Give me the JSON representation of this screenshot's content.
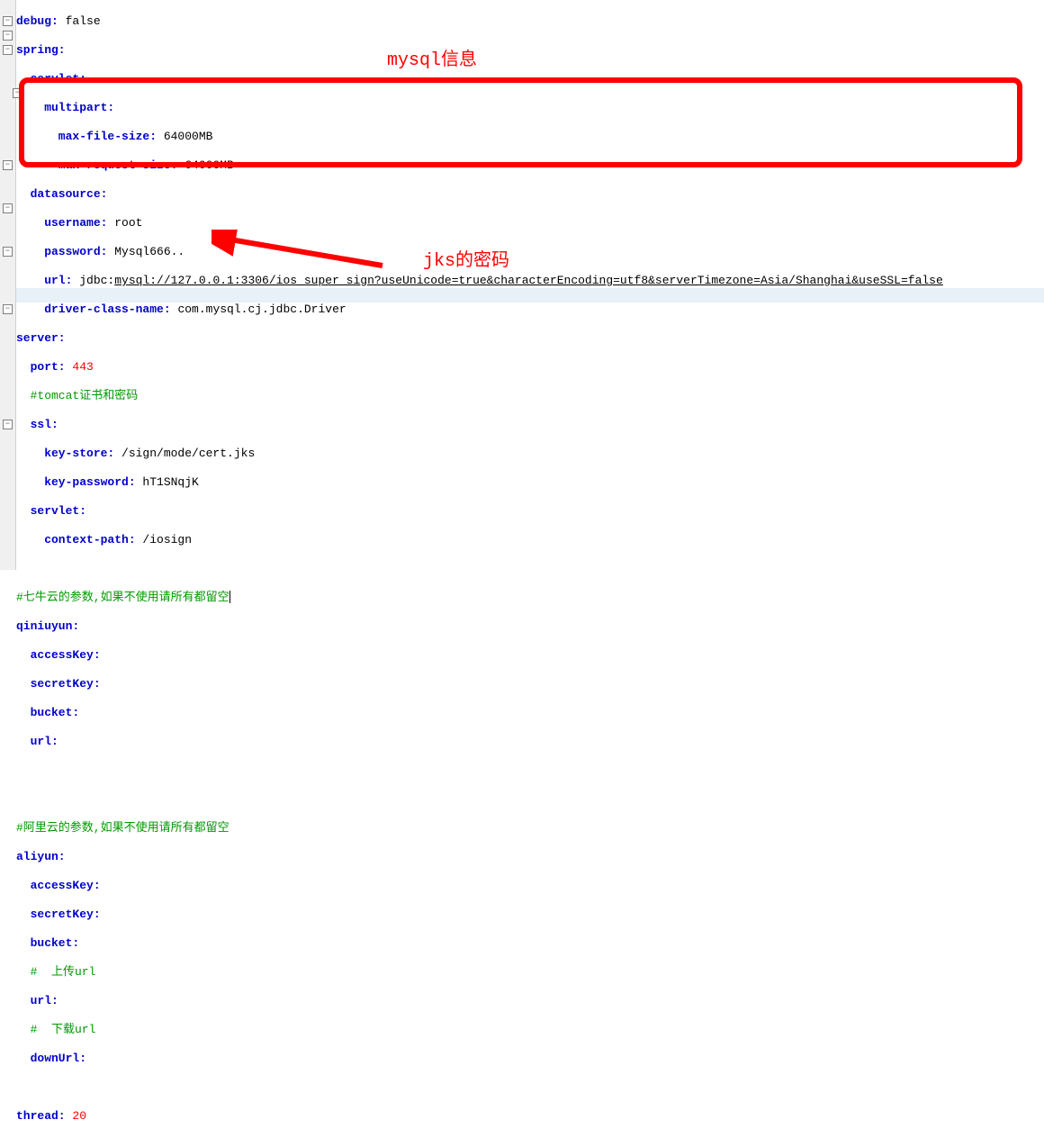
{
  "lines": {
    "l1_k": "debug:",
    "l1_v": " false",
    "l2_k": "spring:",
    "l3_k": "  servlet:",
    "l4_k": "    multipart:",
    "l5_k": "      max-file-size:",
    "l5_v": " 64000MB",
    "l6_k": "      max-request-size:",
    "l6_v": " 64000MB",
    "l7_k": "  datasource:",
    "l8_k": "    username:",
    "l8_v": " root",
    "l9_k": "    password:",
    "l9_v": " Mysql666..",
    "l10_k": "    url:",
    "l10_v1": " jdbc:",
    "l10_v2": "mysql://127.0.0.1:3306/ios_super_sign?useUnicode=true&characterEncoding=utf8&serverTimezone=Asia/Shanghai&useSSL=false",
    "l11_k": "    driver-class-name:",
    "l11_v": " com.mysql.cj.jdbc.Driver",
    "l12_k": "server:",
    "l13_k": "  port:",
    "l13_v": " 443",
    "l14_c": "  #tomcat证书和密码",
    "l15_k": "  ssl:",
    "l16_k": "    key-store:",
    "l16_v": " /sign/mode/cert.jks",
    "l17_k": "    key-password:",
    "l17_v": " hT1SNqjK",
    "l18_k": "  servlet:",
    "l19_k": "    context-path:",
    "l19_v": " /iosign",
    "l20": "",
    "l21_c": "#七牛云的参数,如果不使用请所有都留空",
    "l22_k": "qiniuyun:",
    "l23_k": "  accessKey:",
    "l24_k": "  secretKey:",
    "l25_k": "  bucket:",
    "l26_k": "  url:",
    "l27": "",
    "l28": "",
    "l29_c": "#阿里云的参数,如果不使用请所有都留空",
    "l30_k": "aliyun:",
    "l31_k": "  accessKey:",
    "l32_k": "  secretKey:",
    "l33_k": "  bucket:",
    "l34_c": "  #  上传url",
    "l35_k": "  url:",
    "l36_c": "  #  下载url",
    "l37_k": "  downUrl:",
    "l38": "",
    "l39_k": "thread:",
    "l39_v": " 20"
  },
  "annotations": {
    "mysql": "mysql信息",
    "jks": "jks的密码"
  },
  "fold_symbol": "−"
}
